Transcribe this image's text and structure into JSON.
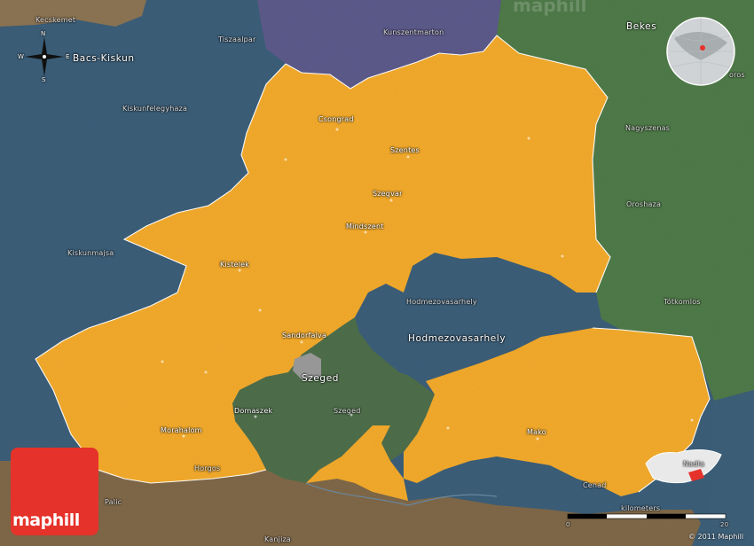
{
  "brand": {
    "logo_text": "maphill",
    "copyright": "© 2011 Maphill",
    "watermark": "maphill"
  },
  "compass": {
    "north": "N",
    "south": "S",
    "west": "W",
    "east": "E"
  },
  "scale": {
    "label": "kilometers",
    "start": "0",
    "end": "20"
  },
  "colors": {
    "county": "#f2aa2c",
    "bacs_kiskun": "#3b5e78",
    "jasz": "#5c5a8a",
    "bekes": "#4f7a49",
    "szeged_area": "#4e6e4a",
    "serbia": "#7f6848",
    "romania": "#3d5f78"
  },
  "places": [
    {
      "name": "Kecskemet"
    },
    {
      "name": "Tiszaalpar"
    },
    {
      "name": "Kunszentmarton"
    },
    {
      "name": "Bekes"
    },
    {
      "name": "Bacs-Kiskun"
    },
    {
      "name": "Kiskunfelegyhaza"
    },
    {
      "name": "Csongrad"
    },
    {
      "name": "Szentes"
    },
    {
      "name": "Nagyszenas"
    },
    {
      "name": "Szegvar"
    },
    {
      "name": "Oroshaza"
    },
    {
      "name": "Mindszent"
    },
    {
      "name": "Kiskunmajsa"
    },
    {
      "name": "Kistelek"
    },
    {
      "name": "Hodmezovasarhely"
    },
    {
      "name": "Tótkomlos"
    },
    {
      "name": "Hodmezovasarhely"
    },
    {
      "name": "Sandorfalva"
    },
    {
      "name": "Szeged"
    },
    {
      "name": "Domaszek"
    },
    {
      "name": "Szeged"
    },
    {
      "name": "Morahalom"
    },
    {
      "name": "Mako"
    },
    {
      "name": "Horgos"
    },
    {
      "name": "Cenad"
    },
    {
      "name": "Nadla"
    },
    {
      "name": "Palic"
    },
    {
      "name": "Kanjiza"
    },
    {
      "name": "oros"
    }
  ]
}
